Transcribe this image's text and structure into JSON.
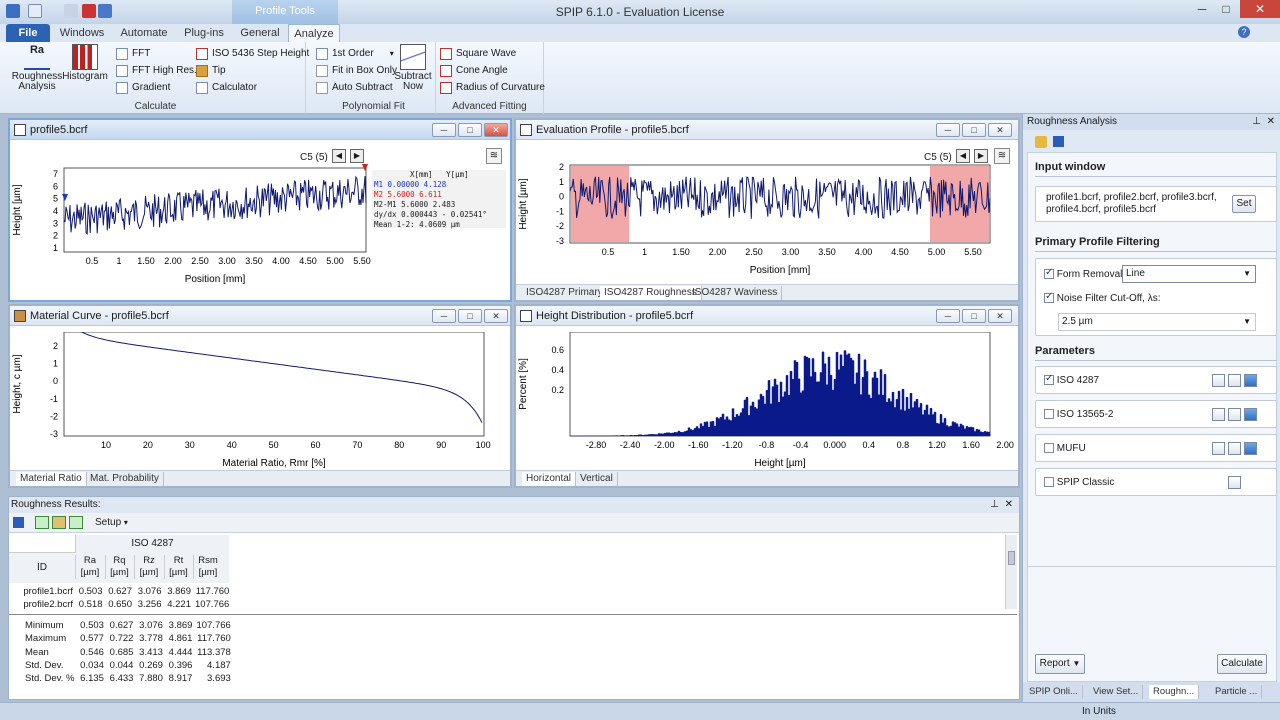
{
  "window": {
    "title": "SPIP 6.1.0 - Evaluation License",
    "context_tab": "Profile Tools",
    "min": "─",
    "max": "□",
    "close": "✕"
  },
  "ribbon_tabs": [
    "File",
    "Windows",
    "Automate",
    "Plug-ins",
    "General",
    "Analyze"
  ],
  "ribbon": {
    "calculate": {
      "label": "Calculate",
      "roughness": "Roughness Analysis",
      "histogram": "Histogram",
      "fft": "FFT",
      "fft_high": "FFT High Res.",
      "gradient": "Gradient",
      "iso5436": "ISO 5436 Step Height",
      "tip": "Tip",
      "calculator": "Calculator"
    },
    "polyfit": {
      "label": "Polynomial Fit",
      "order": "1st Order",
      "fit_box": "Fit in Box Only",
      "auto_subtract": "Auto Subtract",
      "subtract_now": "Subtract Now"
    },
    "advanced": {
      "label": "Advanced Fitting",
      "square_wave": "Square Wave",
      "cone_angle": "Cone Angle",
      "radius": "Radius of Curvature"
    }
  },
  "pane_profile": {
    "title": "profile5.bcrf",
    "nav": "C5 (5)",
    "ylabel": "Height [µm]",
    "xlabel": "Position [mm]",
    "yticks": [
      "7",
      "6",
      "5",
      "4",
      "3",
      "2",
      "1"
    ],
    "xticks": [
      "0.5",
      "1",
      "1.50",
      "2.00",
      "2.50",
      "3.00",
      "3.50",
      "4.00",
      "4.50",
      "5.00",
      "5.50"
    ],
    "readout": {
      "h1": "X[mm]",
      "h2": "Y[µm]",
      "rows": [
        {
          "k": "M1",
          "x": "0.00000",
          "y": "4.128",
          "c": "#1a36c8"
        },
        {
          "k": "M2",
          "x": "5.6000",
          "y": "6.611",
          "c": "#d02020"
        },
        {
          "k": "M2-M1",
          "x": "5.6000",
          "y": "2.483",
          "c": "#222"
        }
      ],
      "dydx": "dy/dx 0.000443 - 0.02541°",
      "mean": "Mean 1-2:  4.0609 µm"
    }
  },
  "pane_eval": {
    "title": "Evaluation Profile - profile5.bcrf",
    "nav": "C5 (5)",
    "ylabel": "Height [µm]",
    "xlabel": "Position [mm]",
    "yticks": [
      "2",
      "1",
      "0",
      "-1",
      "-2",
      "-3"
    ],
    "xticks": [
      "0.5",
      "1",
      "1.50",
      "2.00",
      "2.50",
      "3.00",
      "3.50",
      "4.00",
      "4.50",
      "5.00",
      "5.50"
    ],
    "tabs": [
      "ISO4287 Primary",
      "ISO4287 Roughness",
      "ISO4287 Waviness"
    ]
  },
  "pane_material": {
    "title": "Material Curve - profile5.bcrf",
    "ylabel": "Height, c µm]",
    "xlabel": "Material Ratio, Rmr [%]",
    "yticks": [
      "2",
      "1",
      "0",
      "-1",
      "-2",
      "-3"
    ],
    "xticks": [
      "10",
      "20",
      "30",
      "40",
      "50",
      "60",
      "70",
      "80",
      "90",
      "100"
    ],
    "tabs": [
      "Material Ratio",
      "Mat. Probability"
    ]
  },
  "pane_hist": {
    "title": "Height Distribution - profile5.bcrf",
    "ylabel": "Percent [%]",
    "xlabel": "Height [µm]",
    "yticks": [
      "0.6",
      "0.4",
      "0.2"
    ],
    "xticks": [
      "-2.80",
      "-2.40",
      "-2.00",
      "-1.60",
      "-1.20",
      "-0.8",
      "-0.4",
      "0.000",
      "0.4",
      "0.8",
      "1.20",
      "1.60",
      "2.00"
    ],
    "tabs": [
      "Horizontal",
      "Vertical"
    ]
  },
  "results": {
    "title": "Roughness Results:",
    "setup": "Setup",
    "group": "ISO 4287",
    "id": "ID",
    "cols": [
      [
        "Ra",
        "[µm]"
      ],
      [
        "Rq",
        "[µm]"
      ],
      [
        "Rz",
        "[µm]"
      ],
      [
        "Rt",
        "[µm]"
      ],
      [
        "Rsm",
        "[µm]"
      ]
    ],
    "rows": [
      [
        "profile1.bcrf",
        "0.503",
        "0.627",
        "3.076",
        "3.869",
        "117.760"
      ],
      [
        "profile2.bcrf",
        "0.518",
        "0.650",
        "3.256",
        "4.221",
        "107.766"
      ]
    ],
    "stats": [
      [
        "Minimum",
        "0.503",
        "0.627",
        "3.076",
        "3.869",
        "107.766"
      ],
      [
        "Maximum",
        "0.577",
        "0.722",
        "3.778",
        "4.861",
        "117.760"
      ],
      [
        "Mean",
        "0.546",
        "0.685",
        "3.413",
        "4.444",
        "113.378"
      ],
      [
        "Std. Dev.",
        "0.034",
        "0.044",
        "0.269",
        "0.396",
        "4.187"
      ],
      [
        "Std. Dev. %",
        "6.135",
        "6.433",
        "7.880",
        "8.917",
        "3.693"
      ]
    ]
  },
  "right": {
    "title": "Roughness Analysis",
    "input_hdr": "Input window",
    "input_text": "profile1.bcrf, profile2.bcrf, profile3.bcrf, profile4.bcrf, profile5.bcrf",
    "set": "Set",
    "filter_hdr": "Primary Profile Filtering",
    "form_removal": "Form Removal:",
    "form_value": "Line",
    "noise": "Noise Filter Cut-Off, λs:",
    "noise_value": "2.5 µm",
    "params_hdr": "Parameters",
    "params": [
      {
        "label": "ISO 4287",
        "checked": true
      },
      {
        "label": "ISO 13565-2",
        "checked": false
      },
      {
        "label": "MUFU",
        "checked": false
      },
      {
        "label": "SPIP Classic",
        "checked": false
      }
    ],
    "report": "Report",
    "calculate": "Calculate",
    "bottom_tabs": [
      "SPIP Onli...",
      "View Set...",
      "Roughn...",
      "Particle ..."
    ]
  },
  "status": {
    "units": "In Units"
  }
}
